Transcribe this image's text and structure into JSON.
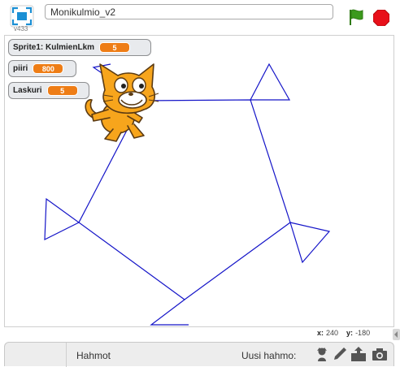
{
  "top_bar": {
    "version": "v433",
    "project_title": "Monikulmio_v2",
    "icons": [
      "fullscreen-icon",
      "green-flag-icon",
      "stop-icon"
    ]
  },
  "stage": {
    "pen_color": "#1414c8",
    "monitors": [
      {
        "label": "Sprite1: KulmienLkm",
        "value": "5"
      },
      {
        "label": "piiri",
        "value": "800"
      },
      {
        "label": "Laskuri",
        "value": "5"
      }
    ],
    "sprite": "scratch-cat"
  },
  "coords": {
    "x_label": "x:",
    "x_value": "240",
    "y_label": "y:",
    "y_value": "-180"
  },
  "sprite_pane": {
    "sprites_label": "Hahmot",
    "new_sprite_label": "Uusi hahmo:",
    "tools": [
      "choose-sprite-icon",
      "paint-sprite-icon",
      "upload-sprite-icon",
      "camera-icon"
    ]
  },
  "colors": {
    "monitor_value": "#ee7d16",
    "flag": "#3b9a1c",
    "stop": "#e8101a",
    "accent": "#1b8fd4"
  }
}
